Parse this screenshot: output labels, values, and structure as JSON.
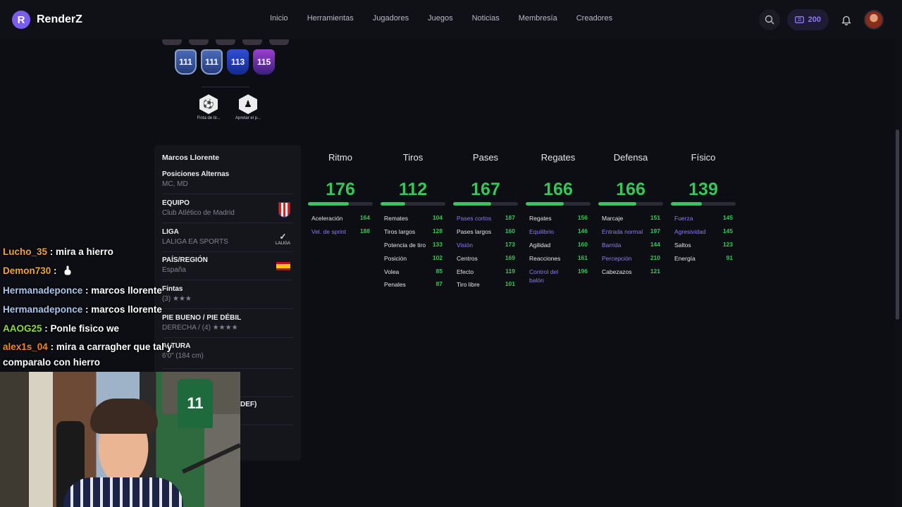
{
  "app": {
    "logo_letter": "R",
    "name": "RenderZ"
  },
  "nav": [
    "Inicio",
    "Herramientas",
    "Jugadores",
    "Juegos",
    "Noticias",
    "Membresía",
    "Creadores"
  ],
  "top_right": {
    "coins": "200"
  },
  "card_chips": [
    "111",
    "111",
    "113",
    "115"
  ],
  "playstyles": [
    {
      "label": "Finta de tir...",
      "icon": "ball-feint-icon"
    },
    {
      "label": "Apretar el p...",
      "icon": "press-icon"
    }
  ],
  "info": {
    "name": "Marcos Llorente",
    "rows": [
      {
        "label": "Posiciones Alternas",
        "value": "MC, MD"
      },
      {
        "label": "EQUIPO",
        "value": "Club Atlético de Madrid"
      },
      {
        "label": "LIGA",
        "value": "LALIGA EA SPORTS"
      },
      {
        "label": "PAÍS/REGIÓN",
        "value": "España"
      },
      {
        "label": "Fintas",
        "value": "(3) ★★★"
      },
      {
        "label": "PIE BUENO / PIE DÉBIL",
        "value": "DERECHA / (4) ★★★★"
      },
      {
        "label": "ALTURA",
        "value": "6'0\" (184 cm)"
      }
    ],
    "laliga_mark": "LALIGA",
    "peek_text": "DEF)"
  },
  "stats": [
    {
      "title": "Ritmo",
      "total": "176",
      "fill": 0.63,
      "rows": [
        {
          "name": "Aceleración",
          "value": "164",
          "hl": false
        },
        {
          "name": "Vel. de sprint",
          "value": "188",
          "hl": true
        }
      ]
    },
    {
      "title": "Tiros",
      "total": "112",
      "fill": 0.38,
      "rows": [
        {
          "name": "Remates",
          "value": "104",
          "hl": false
        },
        {
          "name": "Tiros largos",
          "value": "128",
          "hl": false
        },
        {
          "name": "Potencia de tiro",
          "value": "133",
          "hl": false
        },
        {
          "name": "Posición",
          "value": "102",
          "hl": false
        },
        {
          "name": "Volea",
          "value": "85",
          "hl": false
        },
        {
          "name": "Penales",
          "value": "87",
          "hl": false
        }
      ]
    },
    {
      "title": "Pases",
      "total": "167",
      "fill": 0.59,
      "rows": [
        {
          "name": "Pases cortos",
          "value": "187",
          "hl": true
        },
        {
          "name": "Pases largos",
          "value": "160",
          "hl": false
        },
        {
          "name": "Visión",
          "value": "173",
          "hl": true
        },
        {
          "name": "Centros",
          "value": "169",
          "hl": false
        },
        {
          "name": "Efecto",
          "value": "119",
          "hl": false
        },
        {
          "name": "Tiro libre",
          "value": "101",
          "hl": false
        }
      ]
    },
    {
      "title": "Regates",
      "total": "166",
      "fill": 0.59,
      "rows": [
        {
          "name": "Regates",
          "value": "156",
          "hl": false
        },
        {
          "name": "Equilibrio",
          "value": "146",
          "hl": true
        },
        {
          "name": "Agilidad",
          "value": "160",
          "hl": false
        },
        {
          "name": "Reacciones",
          "value": "161",
          "hl": false
        },
        {
          "name": "Control del balón",
          "value": "196",
          "hl": true
        }
      ]
    },
    {
      "title": "Defensa",
      "total": "166",
      "fill": 0.59,
      "rows": [
        {
          "name": "Marcaje",
          "value": "151",
          "hl": false
        },
        {
          "name": "Entrada normal",
          "value": "197",
          "hl": true
        },
        {
          "name": "Barrida",
          "value": "144",
          "hl": true
        },
        {
          "name": "Percepción",
          "value": "210",
          "hl": true
        },
        {
          "name": "Cabezazos",
          "value": "121",
          "hl": false
        }
      ]
    },
    {
      "title": "Físico",
      "total": "139",
      "fill": 0.48,
      "rows": [
        {
          "name": "Fuerza",
          "value": "145",
          "hl": true
        },
        {
          "name": "Agresividad",
          "value": "145",
          "hl": true
        },
        {
          "name": "Saltos",
          "value": "123",
          "hl": false
        },
        {
          "name": "Energía",
          "value": "91",
          "hl": false
        }
      ]
    }
  ],
  "chat": [
    {
      "user": "Lucho_35",
      "text": " : mira a hierro",
      "cls": "u1"
    },
    {
      "user": "Demon730",
      "text": " : ",
      "cls": "u2",
      "emoji": "hand"
    },
    {
      "user": "Hermanadeponce",
      "text": " : marcos llorente",
      "cls": "u3"
    },
    {
      "user": "Hermanadeponce",
      "text": " : marcos llorente",
      "cls": "u3"
    },
    {
      "user": "AAOG25",
      "text": " : Ponle fisico we",
      "cls": "u4"
    },
    {
      "user": "alex1s_04",
      "text": " : mira a carragher que tal y comparalo con hierro",
      "cls": "u5",
      "wrap": true
    }
  ]
}
